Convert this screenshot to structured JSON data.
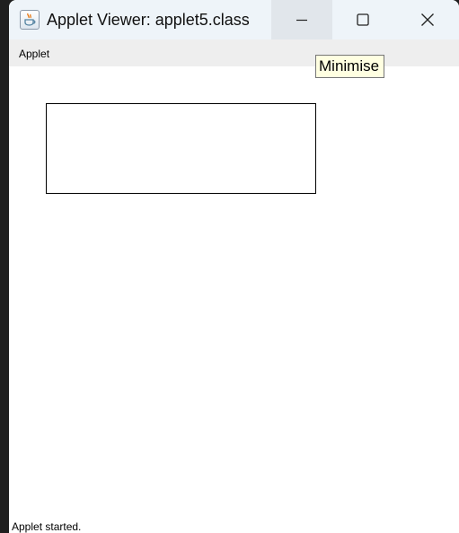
{
  "window": {
    "title": "Applet Viewer: applet5.class",
    "app_icon": "java-cup-icon"
  },
  "controls": {
    "minimize_icon": "minimize-icon",
    "maximize_icon": "maximize-icon",
    "close_icon": "close-icon"
  },
  "menubar": {
    "items": [
      {
        "label": "Applet"
      }
    ]
  },
  "status": {
    "text": "Applet started."
  },
  "tooltip": {
    "text": "Minimise"
  },
  "colors": {
    "titlebar_bg": "#eef4f9",
    "menubar_bg": "#eeeeee",
    "tooltip_bg": "#ffffe1",
    "rectangle_stroke": "#000000"
  }
}
